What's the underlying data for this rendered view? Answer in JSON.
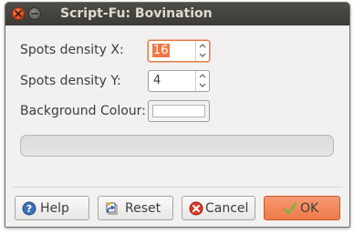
{
  "window": {
    "title": "Script-Fu: Bovination"
  },
  "form": {
    "spots_x_label": "Spots density X:",
    "spots_x_value": "16",
    "spots_y_label": "Spots density Y:",
    "spots_y_value": "4",
    "bg_colour_label": "Background Colour:",
    "bg_colour_value": "#ffffff"
  },
  "progress": {
    "fraction": 0
  },
  "buttons": {
    "help": "Help",
    "reset": "Reset",
    "cancel": "Cancel",
    "ok": "OK"
  },
  "colors": {
    "accent": "#f07746",
    "titlebar": "#3c3b37",
    "close_button": "#e0491c"
  },
  "icons": {
    "close": "close-icon",
    "minimize": "minimize-icon",
    "help": "help-icon",
    "reset": "reset-icon",
    "cancel": "cancel-icon",
    "ok": "checkmark-icon"
  }
}
